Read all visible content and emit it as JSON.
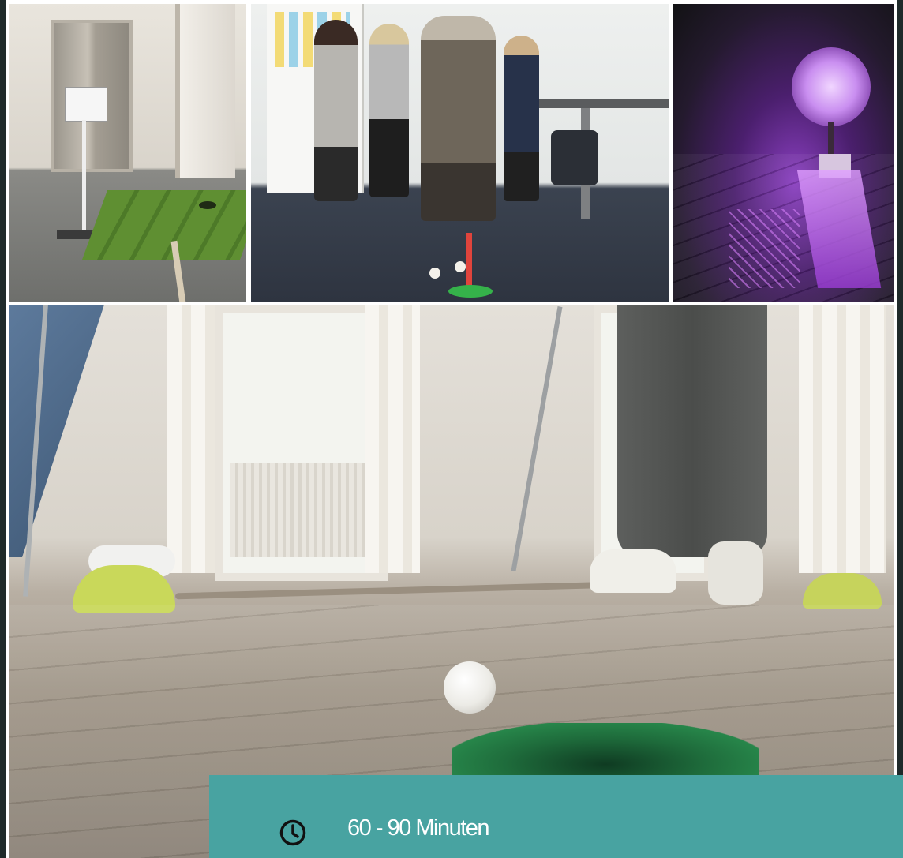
{
  "gallery": {
    "images": [
      {
        "name": "elevator-putting-mat-photo"
      },
      {
        "name": "office-team-golf-photo"
      },
      {
        "name": "purple-rooftop-photo"
      },
      {
        "name": "floor-golf-ball-photo"
      }
    ]
  },
  "info": {
    "icon": "clock-icon",
    "duration_text": "60 - 90 Minuten",
    "band_color": "#48a3a1",
    "text_color": "#ffffff"
  }
}
